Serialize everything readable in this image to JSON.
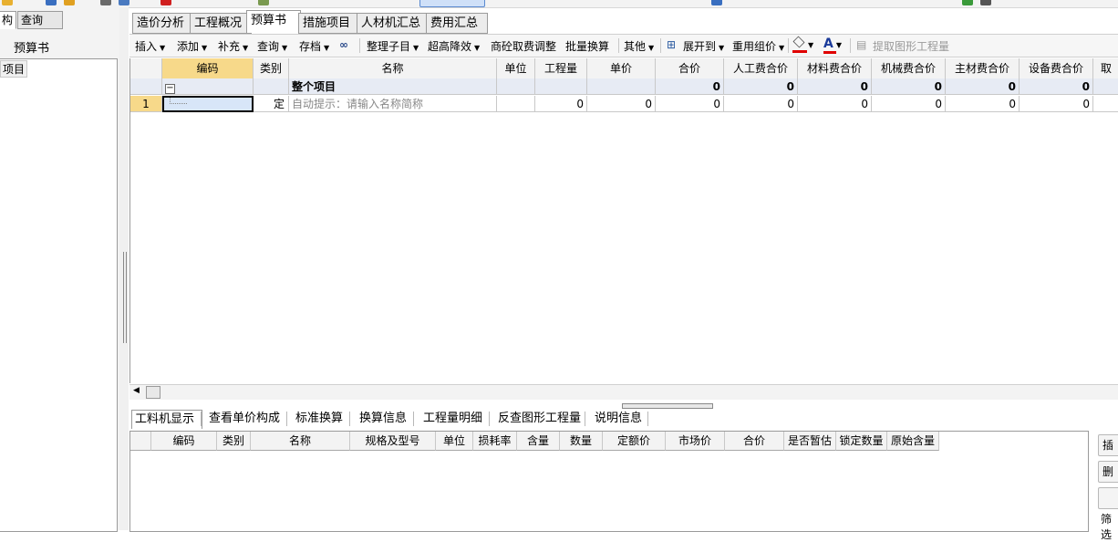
{
  "left_panel": {
    "tabs": [
      "构",
      "查询"
    ],
    "header": "预算书",
    "tree_item": "项目"
  },
  "main_tabs": [
    "造价分析",
    "工程概况",
    "预算书",
    "措施项目",
    "人材机汇总",
    "费用汇总"
  ],
  "active_main_tab": "预算书",
  "toolbar": {
    "insert": "插入",
    "add": "添加",
    "supplement": "补充",
    "query": "查询",
    "archive": "存档",
    "organize": "整理子目",
    "super_high": "超高降效",
    "concrete": "商砼取费调整",
    "batch": "批量换算",
    "other": "其他",
    "expand": "展开到",
    "reuse": "重用组价",
    "extract": "提取图形工程量"
  },
  "grid": {
    "headers": [
      "编码",
      "类别",
      "名称",
      "单位",
      "工程量",
      "单价",
      "合价",
      "人工费合价",
      "材料费合价",
      "机械费合价",
      "主材费合价",
      "设备费合价",
      "取"
    ],
    "summary_row": {
      "toggle": "−",
      "name": "整个项目",
      "values": [
        "0",
        "0",
        "0",
        "0",
        "0",
        "0"
      ]
    },
    "data_row": {
      "index": "1",
      "category": "定",
      "name_hint": "自动提示：请输入名称简称",
      "values": [
        "0",
        "0",
        "0",
        "0",
        "0",
        "0",
        "0",
        "0"
      ]
    }
  },
  "bottom_tabs": [
    "工料机显示",
    "查看单价构成",
    "标准换算",
    "换算信息",
    "工程量明细",
    "反查图形工程量",
    "说明信息"
  ],
  "active_bottom_tab": "工料机显示",
  "bottom_grid": {
    "headers": [
      "编码",
      "类别",
      "名称",
      "规格及型号",
      "单位",
      "损耗率",
      "含量",
      "数量",
      "定额价",
      "市场价",
      "合价",
      "是否暂估",
      "锁定数量",
      "原始含量"
    ]
  },
  "side_buttons": [
    "插",
    "删",
    "",
    "筛选"
  ],
  "colors": {
    "selected_header": "#f7d98a",
    "summary_row_bg": "#e7ebf4",
    "color_tool_red": "#e00000"
  }
}
